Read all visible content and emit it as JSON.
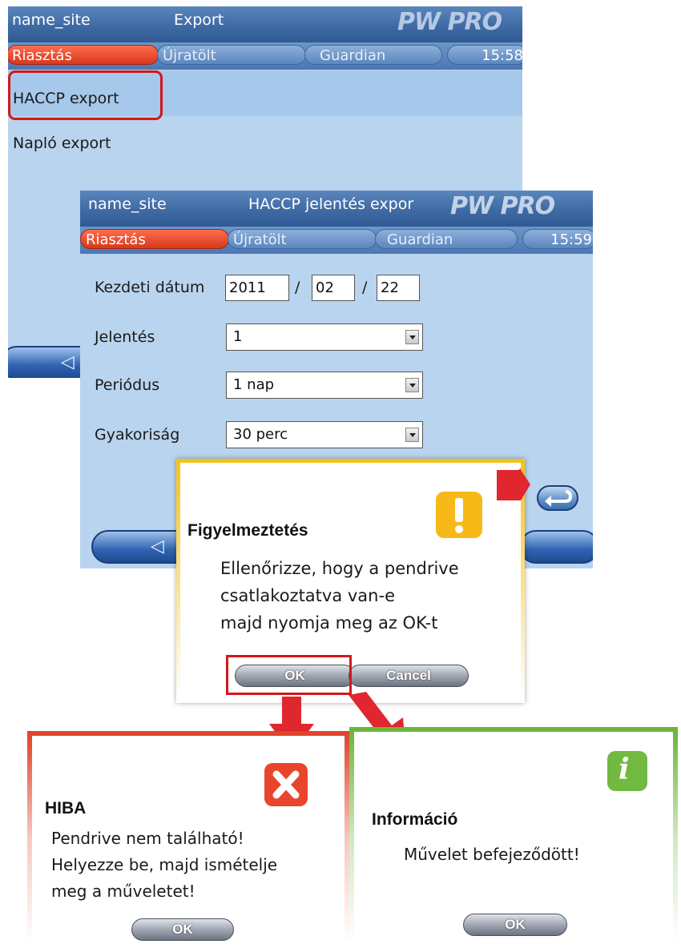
{
  "screen1": {
    "site": "name_site",
    "title": "Export",
    "logo": "PW PRO",
    "tabs": {
      "alarm": "Riasztás",
      "reload": "Újratölt",
      "guardian": "Guardian",
      "clock": "15:58"
    },
    "menu": [
      "HACCP export",
      "Napló export"
    ]
  },
  "screen2": {
    "site": "name_site",
    "title": "HACCP jelentés expor",
    "logo": "PW PRO",
    "tabs": {
      "alarm": "Riasztás",
      "reload": "Újratölt",
      "guardian": "Guardian",
      "clock": "15:59"
    },
    "start_date": {
      "label": "Kezdeti dátum",
      "year": "2011",
      "month": "02",
      "day": "22",
      "sep": "/"
    },
    "report": {
      "label": "Jelentés",
      "value": "1"
    },
    "period": {
      "label": "Periódus",
      "value": "1 nap"
    },
    "frequency": {
      "label": "Gyakoriság",
      "value": "30 perc"
    }
  },
  "warning_dialog": {
    "title": "Figyelmeztetés",
    "icon": "exclamation-icon",
    "lines": [
      "Ellenőrizze, hogy a pendrive",
      "csatlakoztatva van-e",
      "majd nyomja meg az OK-t"
    ],
    "ok": "OK",
    "cancel": "Cancel",
    "color": "#f7c21b"
  },
  "error_dialog": {
    "title": "HIBA",
    "icon": "x-icon",
    "lines": [
      "Pendrive nem található!",
      "Helyezze be, majd ismételje",
      "meg a műveletet!"
    ],
    "ok": "OK",
    "color": "#e2432c"
  },
  "info_dialog": {
    "title": "Információ",
    "icon": "info-icon",
    "lines": [
      "Művelet befejeződött!"
    ],
    "ok": "OK",
    "color": "#6bb63a"
  }
}
